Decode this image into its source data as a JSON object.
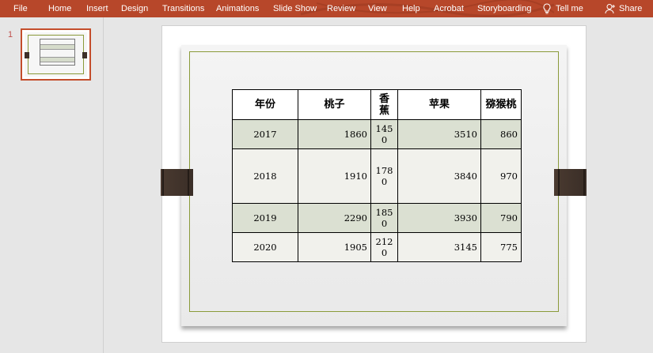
{
  "ribbon": {
    "tabs": {
      "file": "File",
      "home": "Home",
      "insert": "Insert",
      "design": "Design",
      "transitions": "Transitions",
      "animations": "Animations",
      "slideshow": "Slide Show",
      "review": "Review",
      "view": "View",
      "help": "Help",
      "acrobat": "Acrobat",
      "storyboarding": "Storyboarding"
    },
    "tell_me": "Tell me",
    "share": "Share",
    "icons": {
      "tell_me": "lightbulb-icon",
      "share": "person-icon"
    },
    "color": "#b7472a"
  },
  "thumbnails": {
    "slide_number": "1",
    "selected_color": "#c44d2b"
  },
  "slide": {
    "border_color": "#8a9a3a",
    "table": {
      "headers": [
        "年份",
        "桃子",
        "香蕉",
        "苹果",
        "猕猴桃"
      ],
      "rows": [
        [
          "2017",
          "1860",
          "1450",
          "3510",
          "860"
        ],
        [
          "2018",
          "1910",
          "1780",
          "3840",
          "970"
        ],
        [
          "2019",
          "2290",
          "1850",
          "3930",
          "790"
        ],
        [
          "2020",
          "1905",
          "2120",
          "3145",
          "775"
        ]
      ],
      "shaded_color": "#dbe0d2"
    }
  }
}
